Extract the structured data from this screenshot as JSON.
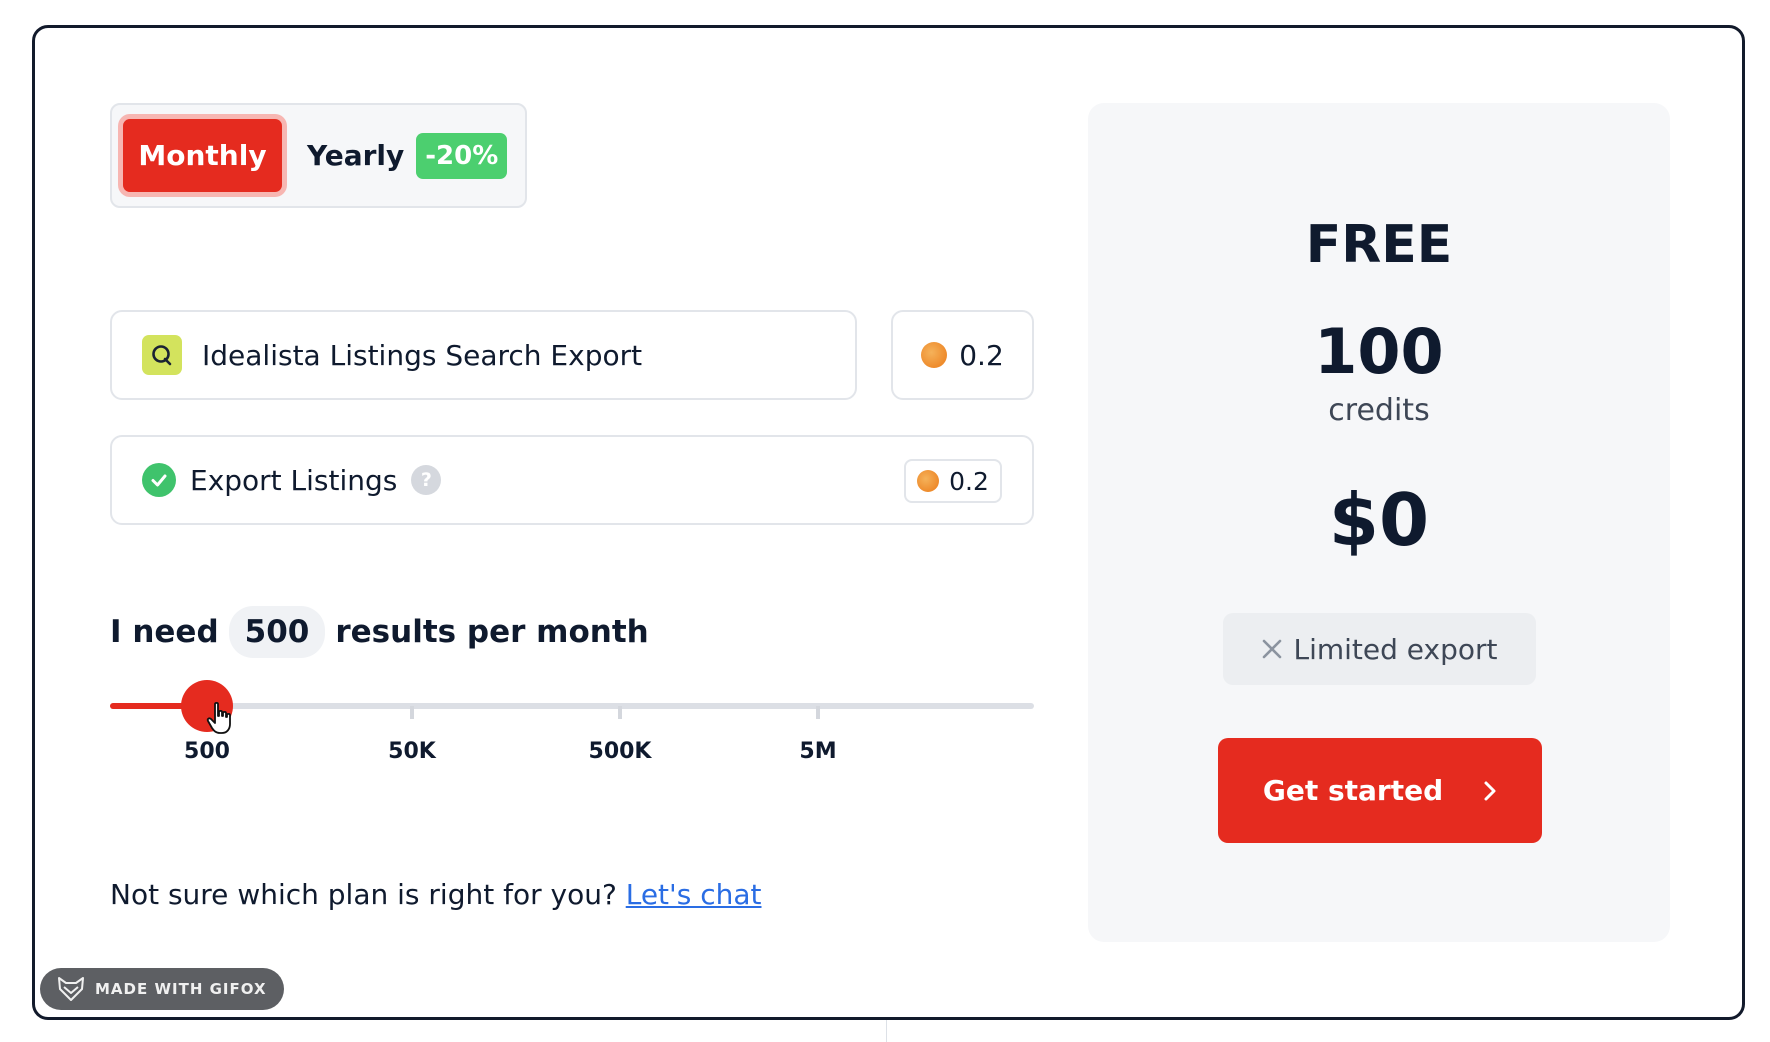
{
  "billing": {
    "monthly_label": "Monthly",
    "yearly_label": "Yearly",
    "yearly_discount": "-20%",
    "selected": "Monthly"
  },
  "actor": {
    "icon": "search-icon",
    "name": "Idealista Listings Search Export",
    "cost": "0.2"
  },
  "feature": {
    "icon": "check-circle-icon",
    "label": "Export Listings",
    "help": "?",
    "cost": "0.2"
  },
  "results": {
    "prefix": "I need",
    "value": "500",
    "suffix": "results per month"
  },
  "slider": {
    "labels": [
      "500",
      "50K",
      "500K",
      "5M"
    ],
    "selected_index": 0
  },
  "help": {
    "text": "Not sure which plan is right for you?",
    "link": "Let's chat"
  },
  "plan": {
    "name": "FREE",
    "credits": "100",
    "credits_unit": "credits",
    "price": "$0",
    "limitation": "Limited export",
    "cta": "Get started"
  },
  "watermark": {
    "text": "MADE WITH GIFOX"
  },
  "colors": {
    "accent": "#e52b1f",
    "discount": "#4ccf6f",
    "link": "#2a6de4"
  }
}
